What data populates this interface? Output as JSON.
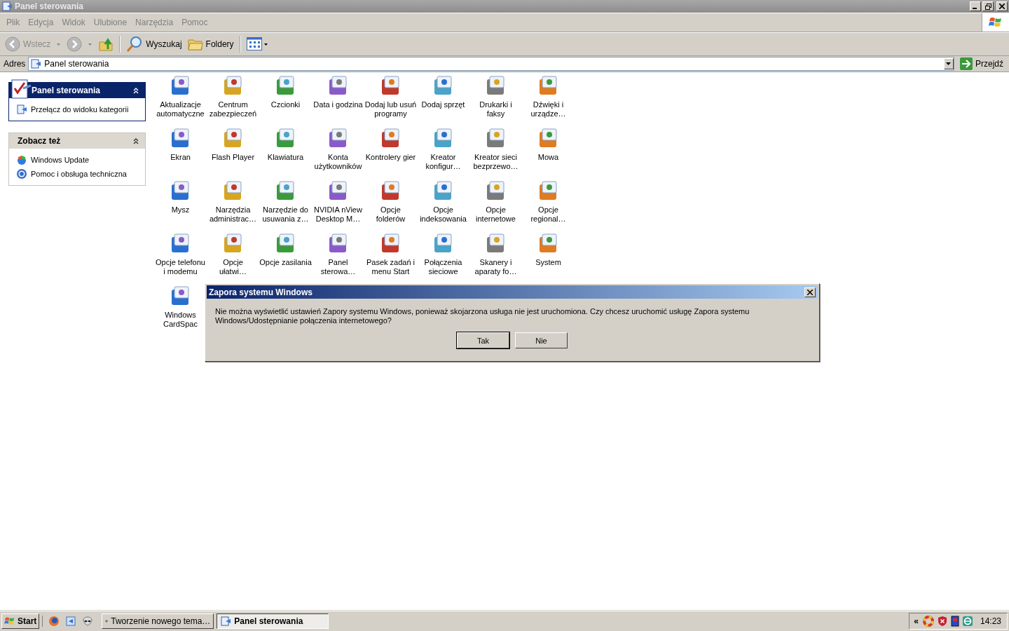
{
  "window": {
    "title": "Panel sterowania"
  },
  "menu": [
    "Plik",
    "Edycja",
    "Widok",
    "Ulubione",
    "Narzędzia",
    "Pomoc"
  ],
  "toolbar": {
    "back": "Wstecz",
    "search": "Wyszukaj",
    "folders": "Foldery"
  },
  "address": {
    "label": "Adres",
    "value": "Panel sterowania",
    "go": "Przejdź"
  },
  "sidebar": [
    {
      "kind": "primary",
      "title": "Panel sterowania",
      "items": [
        "Przełącz do widoku kategorii"
      ]
    },
    {
      "kind": "secondary",
      "title": "Zobacz też",
      "items": [
        "Windows Update",
        "Pomoc i obsługa techniczna"
      ]
    }
  ],
  "applets": [
    {
      "label": "Aktualizacje\nautomatyczne"
    },
    {
      "label": "Centrum\nzabezpieczeń"
    },
    {
      "label": "Czcionki"
    },
    {
      "label": "Data i godzina"
    },
    {
      "label": "Dodaj lub usuń\nprogramy"
    },
    {
      "label": "Dodaj sprzęt"
    },
    {
      "label": "Drukarki i\nfaksy"
    },
    {
      "label": "Dźwięki i\nurządze…"
    },
    {
      "label": "Ekran"
    },
    {
      "label": "Flash Player"
    },
    {
      "label": "Klawiatura"
    },
    {
      "label": "Konta\nużytkowników"
    },
    {
      "label": "Kontrolery gier"
    },
    {
      "label": "Kreator\nkonfigur…"
    },
    {
      "label": "Kreator sieci\nbezprzewo…"
    },
    {
      "label": "Mowa"
    },
    {
      "label": "Mysz"
    },
    {
      "label": "Narzędzia\nadministrac…"
    },
    {
      "label": "Narzędzie do\nusuwania z…"
    },
    {
      "label": "NVIDIA nView\nDesktop M…"
    },
    {
      "label": "Opcje\nfolderów"
    },
    {
      "label": "Opcje\nindeksowania"
    },
    {
      "label": "Opcje\ninternetowe"
    },
    {
      "label": "Opcje\nregional…"
    },
    {
      "label": "Opcje telefonu\ni modemu"
    },
    {
      "label": "Opcje\nułatwi…"
    },
    {
      "label": "Opcje zasilania"
    },
    {
      "label": "Panel\nsterowa…"
    },
    {
      "label": "Pasek zadań i\nmenu Start"
    },
    {
      "label": "Połączenia\nsieciowe"
    },
    {
      "label": "Skanery i\naparaty fo…"
    },
    {
      "label": "System"
    },
    {
      "label": "Windows\nCardSpac"
    }
  ],
  "dialog": {
    "title": "Zapora systemu Windows",
    "message": "Nie można wyświetlić ustawień Zapory systemu Windows, ponieważ skojarzona usługa nie jest uruchomiona. Czy chcesz uruchomić usługę Zapora systemu Windows/Udostępnianie połączenia internetowego?",
    "buttons": [
      "Tak",
      "Nie"
    ]
  },
  "taskbar": {
    "start": "Start",
    "tasks": [
      {
        "label": "Tworzenie nowego tema…",
        "selected": false
      },
      {
        "label": "Panel sterowania",
        "selected": true
      }
    ],
    "tray_toggle": "«",
    "clock": "14:23"
  }
}
